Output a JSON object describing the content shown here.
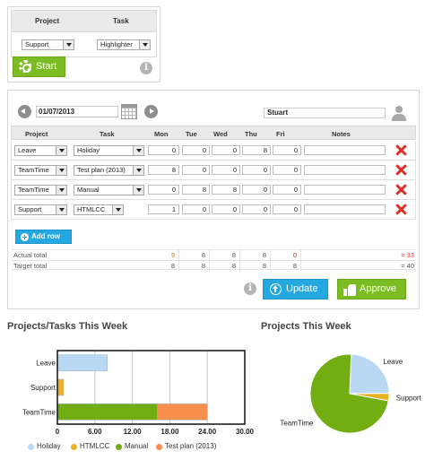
{
  "timer": {
    "headers": {
      "project": "Project",
      "task": "Task"
    },
    "project_value": "Support",
    "task_value": "Highlighter",
    "start_label": "Start",
    "info": "i"
  },
  "timesheet": {
    "date": "01/07/2013",
    "user": "Stuart",
    "headers": {
      "project": "Project",
      "task": "Task",
      "mon": "Mon",
      "tue": "Tue",
      "wed": "Wed",
      "thu": "Thu",
      "fri": "Fri",
      "notes": "Notes"
    },
    "rows": [
      {
        "project": "Leave",
        "task": "Holiday",
        "mon": "0",
        "tue": "0",
        "wed": "0",
        "thu": "8",
        "fri": "0"
      },
      {
        "project": "TeamTime",
        "task": "Test plan (2013)",
        "mon": "8",
        "tue": "0",
        "wed": "0",
        "thu": "0",
        "fri": "0"
      },
      {
        "project": "TeamTime",
        "task": "Manual",
        "mon": "0",
        "tue": "8",
        "wed": "8",
        "thu": "0",
        "fri": "0"
      },
      {
        "project": "Support",
        "task": "HTMLCC",
        "mon": "1",
        "tue": "0",
        "wed": "0",
        "thu": "0",
        "fri": "0"
      }
    ],
    "add_row_label": "Add row",
    "actual_total": {
      "label": "Actual total",
      "mon": "9",
      "tue": "8",
      "wed": "8",
      "thu": "8",
      "fri": "0",
      "sum": "= 33"
    },
    "target_total": {
      "label": "Target total",
      "mon": "8",
      "tue": "8",
      "wed": "8",
      "thu": "8",
      "fri": "8",
      "sum": "= 40"
    },
    "update_label": "Update",
    "approve_label": "Approve",
    "info": "i"
  },
  "colors": {
    "green": "#7cbc23",
    "blue": "#25a8e0",
    "holiday": "#b8d8f4",
    "htmlcc": "#e8b323",
    "manual": "#72ae12",
    "testplan": "#f88f4f",
    "delete": "#d9332a"
  },
  "chart_data": [
    {
      "type": "bar",
      "title": "Projects/Tasks This Week",
      "orientation": "horizontal",
      "stacked": true,
      "categories": [
        "Leave",
        "Support",
        "TeamTime"
      ],
      "series": [
        {
          "name": "Holiday",
          "values": [
            8,
            0,
            0
          ]
        },
        {
          "name": "HTMLCC",
          "values": [
            0,
            1,
            0
          ]
        },
        {
          "name": "Manual",
          "values": [
            0,
            0,
            16
          ]
        },
        {
          "name": "Test plan (2013)",
          "values": [
            0,
            0,
            8
          ]
        }
      ],
      "xlim": [
        0,
        30
      ],
      "xticks": [
        "0",
        "6.00",
        "12.00",
        "18.00",
        "24.00",
        "30.00"
      ],
      "grid": true,
      "legend_position": "bottom"
    },
    {
      "type": "pie",
      "title": "Projects This Week",
      "labels": [
        "Leave",
        "Support",
        "TeamTime"
      ],
      "values": [
        8,
        1,
        24
      ]
    }
  ]
}
